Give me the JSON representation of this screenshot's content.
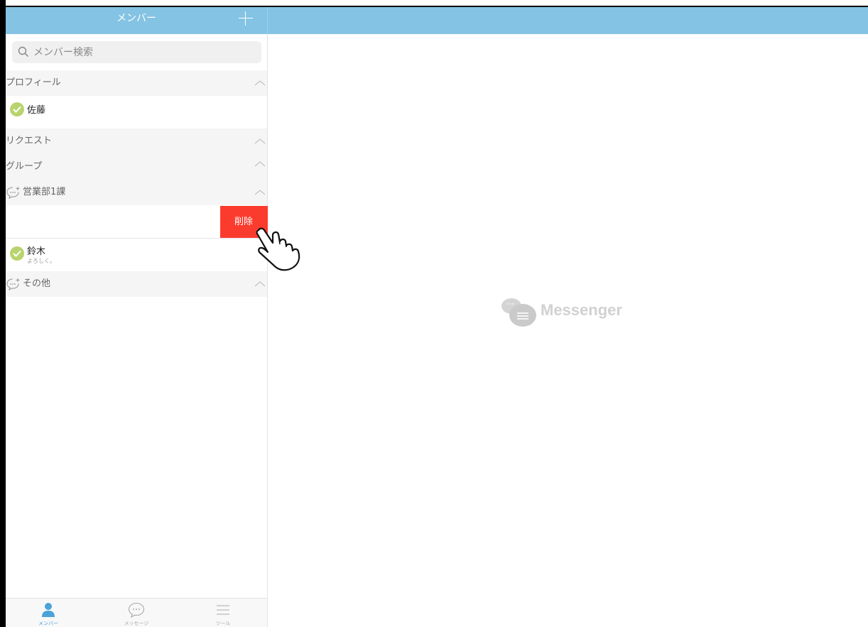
{
  "header": {
    "title": "メンバー"
  },
  "search": {
    "placeholder": "メンバー検索"
  },
  "sections": {
    "profile": "プロフィール",
    "request": "リクエスト",
    "group": "グループ",
    "sales": "営業部1課",
    "other": "その他"
  },
  "members": {
    "profile_member": {
      "name": "佐藤"
    },
    "sales_member": {
      "name": "鈴木",
      "status": "よろしく。"
    }
  },
  "swipe": {
    "delete_label": "削除"
  },
  "tabs": [
    {
      "label": "メンバー"
    },
    {
      "label": "メッセージ"
    },
    {
      "label": "ツール"
    }
  ],
  "brand": {
    "logo_text": "Messenger"
  },
  "colors": {
    "header": "#84c3e3",
    "delete": "#fc3b2f",
    "online_check": "#b8d46e",
    "tab_active": "#4aa3d8"
  }
}
